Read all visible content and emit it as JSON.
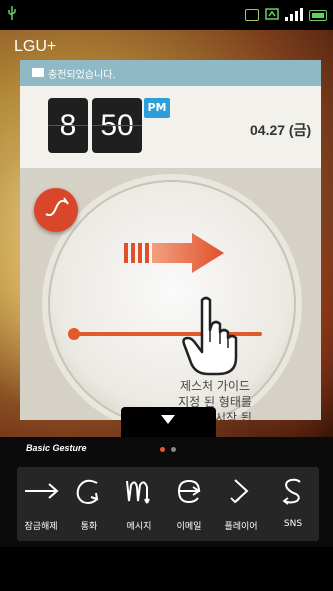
{
  "status_bar": {
    "icons": [
      "usb-icon",
      "screenshot-icon",
      "wifi-icon",
      "signal-icon",
      "battery-icon"
    ]
  },
  "carrier": "LGU+",
  "notification": {
    "text": "충전되었습니다."
  },
  "clock": {
    "hour": "8",
    "minute": "50",
    "ampm": "PM",
    "date": "04.27 (금)"
  },
  "gesture_guide": {
    "text": [
      "제스처 가이드",
      "지정 된 형태를",
      "메뉴가 시작 됩"
    ]
  },
  "colors": {
    "accent": "#e05a2a",
    "pm_badge": "#2a9fd8",
    "notif_bar": "#8fb9c4"
  },
  "panel": {
    "title": "Basic Gesture",
    "page": 1,
    "pages": 2,
    "gestures": [
      {
        "label": "잠금해제",
        "icon": "arrow-right-icon"
      },
      {
        "label": "통화",
        "icon": "curved-arrow-icon"
      },
      {
        "label": "메시지",
        "icon": "m-gesture-icon"
      },
      {
        "label": "이메일",
        "icon": "e-gesture-icon"
      },
      {
        "label": "플레이어",
        "icon": "chevron-gesture-icon"
      },
      {
        "label": "SNS",
        "icon": "s-gesture-icon"
      }
    ]
  }
}
